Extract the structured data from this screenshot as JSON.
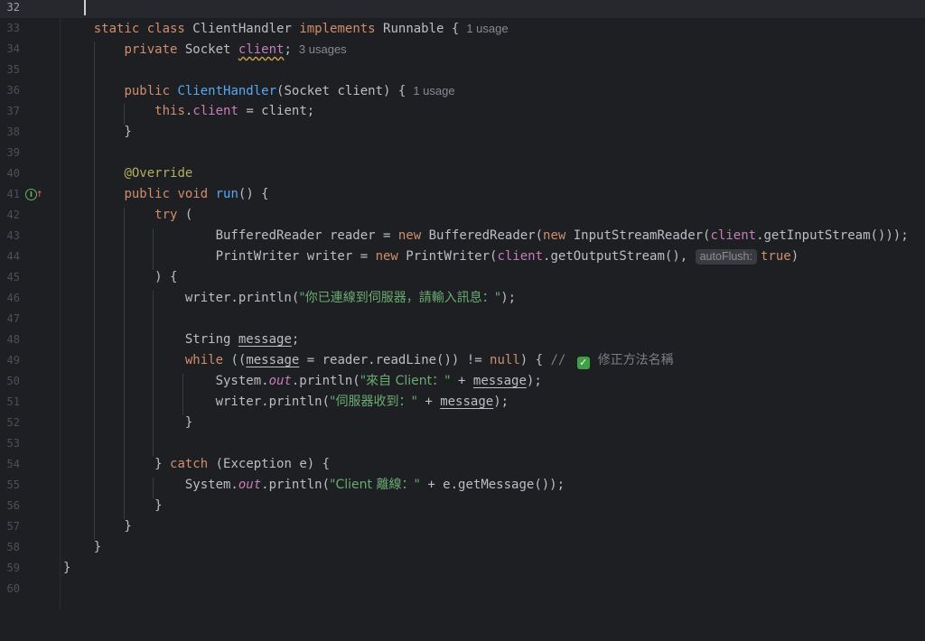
{
  "editor": {
    "lines": [
      32,
      33,
      34,
      35,
      36,
      37,
      38,
      39,
      40,
      41,
      42,
      43,
      44,
      45,
      46,
      47,
      48,
      49,
      50,
      51,
      52,
      53,
      54,
      55,
      56,
      57,
      58,
      59,
      60
    ],
    "usages": {
      "class_usage": "1 usage",
      "field_usage": "3 usages",
      "ctor_usage": "1 usage"
    },
    "param_hint": "autoFlush:",
    "gutter_icon": "implementing-method-icon",
    "strings": {
      "connected": "\"你已連線到伺服器，請輸入訊息：\"",
      "from_client": "\"來自 Client：\"",
      "server_received": "\"伺服器收到：\"",
      "client_left": "\"Client 離線：\""
    },
    "comment": {
      "slashes": "// ",
      "text": "修正方法名稱"
    },
    "colors": {
      "background": "#1e1f22",
      "keyword": "#cf8e6d",
      "function": "#56a8f5",
      "field": "#c77dbb",
      "string": "#6aab73",
      "annotation": "#b3ae60"
    }
  }
}
